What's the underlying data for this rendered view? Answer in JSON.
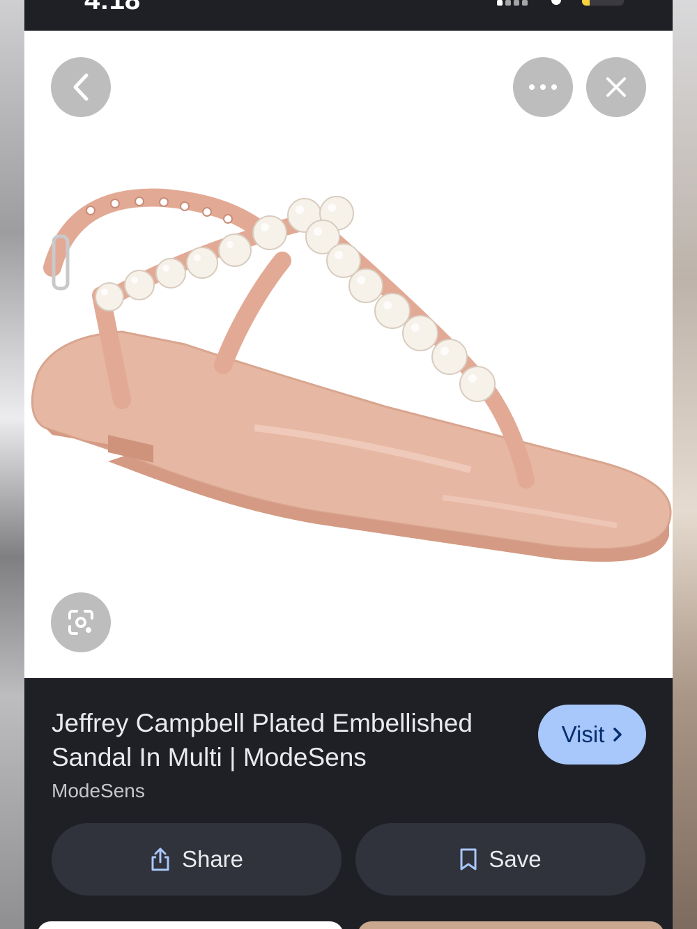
{
  "status_bar": {
    "time": "4:18",
    "battery_level_text": "18",
    "battery_fraction": 0.18
  },
  "image_viewer": {
    "back_icon": "chevron-left-icon",
    "more_icon": "more-horizontal-icon",
    "close_icon": "close-icon",
    "lens_icon": "visual-search-icon"
  },
  "result": {
    "title": "Jeffrey Campbell Plated Embellished Sandal In Multi | ModeSens",
    "source": "ModeSens",
    "visit_label": "Visit",
    "share_label": "Share",
    "save_label": "Save"
  },
  "colors": {
    "panel_bg": "#1f2026",
    "visit_bg": "#a8c7fa",
    "button_bg": "#30323c",
    "sandal": "#e8b8a4",
    "pearl": "#f5f0e8"
  }
}
